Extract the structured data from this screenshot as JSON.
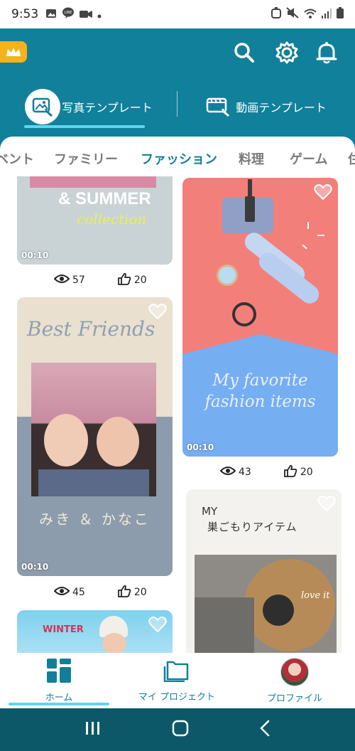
{
  "status_bar": {
    "time": "9:53",
    "left_icons": [
      "image-icon",
      "line-icon",
      "video-icon",
      "dot-icon"
    ],
    "right_icons": [
      "alarm-icon",
      "mute-icon",
      "wifi-icon",
      "signal-icon",
      "battery-icon"
    ]
  },
  "header": {
    "bg_color": "#11809a",
    "premium_icon": "crown-icon",
    "actions": [
      "search-icon",
      "gear-icon",
      "bell-icon"
    ],
    "tabs": [
      {
        "label": "写真テンプレート",
        "icon": "photo-template-icon",
        "active": true
      },
      {
        "label": "動画テンプレート",
        "icon": "video-template-icon",
        "active": false
      }
    ]
  },
  "categories": {
    "items": [
      "ベント",
      "ファミリー",
      "ファッション",
      "料理",
      "ゲーム",
      "住"
    ],
    "active": "ファッション"
  },
  "cards": [
    {
      "text_lines": [
        "& SUMMER",
        "collection"
      ],
      "duration": "00:10",
      "views": "57",
      "likes": "20"
    },
    {
      "text_lines": [
        "My favorite",
        "fashion items"
      ],
      "duration": "00:10",
      "views": "43",
      "likes": "20"
    },
    {
      "text_lines": [
        "Best Friends",
        "みき ＆ かなこ"
      ],
      "duration": "00:10",
      "views": "45",
      "likes": "20"
    },
    {
      "text_lines": [
        "MY",
        "巣ごもりアイテム",
        "love it"
      ],
      "duration": "",
      "views": "",
      "likes": ""
    },
    {
      "text_lines": [
        "WINTER"
      ],
      "duration": "",
      "views": "",
      "likes": ""
    }
  ],
  "bottom_nav": [
    {
      "label": "ホーム",
      "icon": "home-grid-icon",
      "active": true
    },
    {
      "label": "マイ プロジェクト",
      "icon": "folder-icon",
      "active": false
    },
    {
      "label": "プロファイル",
      "icon": "avatar",
      "active": false
    }
  ],
  "system_nav": [
    "recents-icon",
    "home-icon",
    "back-icon"
  ],
  "colors": {
    "accent": "#127f99",
    "highlight": "#5fd6ee",
    "premium": "#f6b21a"
  }
}
